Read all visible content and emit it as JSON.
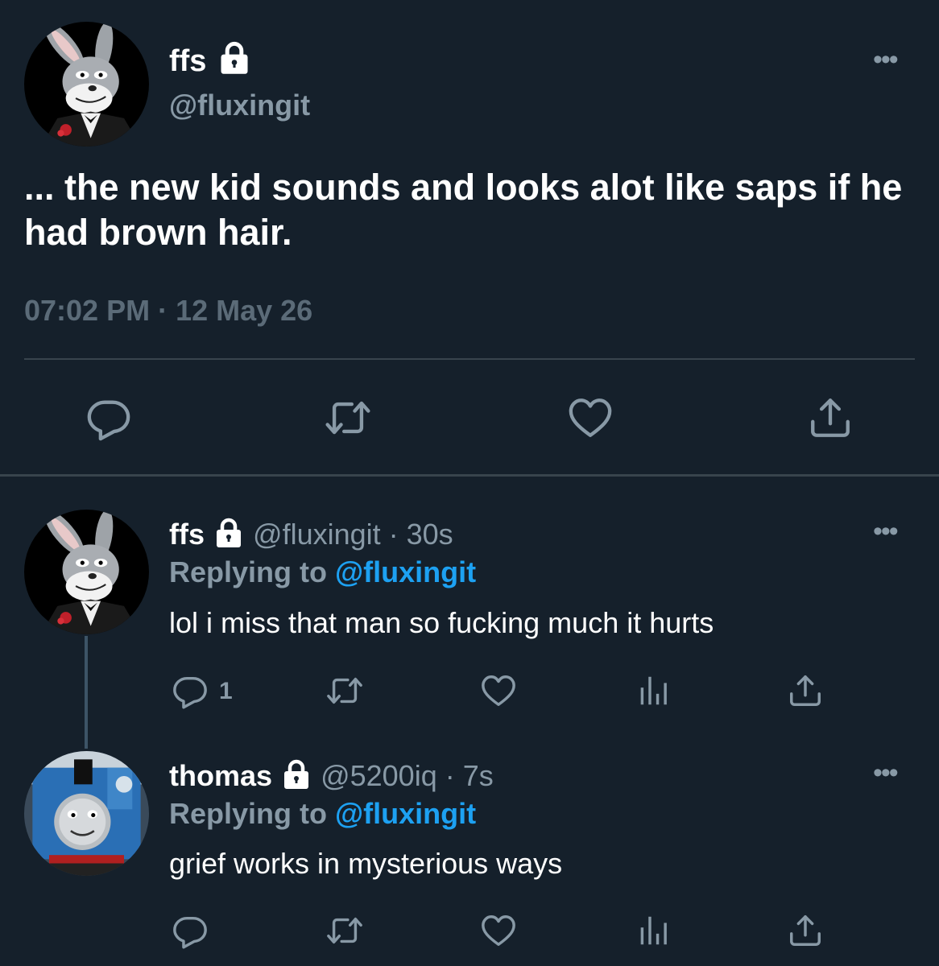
{
  "main_tweet": {
    "display_name": "ffs",
    "handle": "@fluxingit",
    "text": "... the new kid sounds and looks alot like saps if he had brown hair.",
    "timestamp": "07:02 PM · 12 May 26",
    "more_label": "•••",
    "avatar_icon": "bugs-bunny-tuxedo-avatar",
    "lock_icon": "lock-icon"
  },
  "replies": [
    {
      "display_name": "ffs",
      "handle_time": "@fluxingit · 30s",
      "replying_prefix": "Replying to",
      "replying_to": "@fluxingit",
      "text": "lol i miss that man so fucking much it hurts",
      "reply_count": "1",
      "more_label": "•••",
      "avatar_icon": "bugs-bunny-tuxedo-avatar"
    },
    {
      "display_name": "thomas",
      "handle_time": "@5200iq · 7s",
      "replying_prefix": "Replying to",
      "replying_to": "@fluxingit",
      "text": "grief works in mysterious ways",
      "more_label": "•••",
      "avatar_icon": "thomas-tank-engine-avatar"
    }
  ],
  "colors": {
    "background": "#15202b",
    "accent": "#1da1f2",
    "secondary_text": "#8899a6",
    "divider": "#38444d"
  }
}
